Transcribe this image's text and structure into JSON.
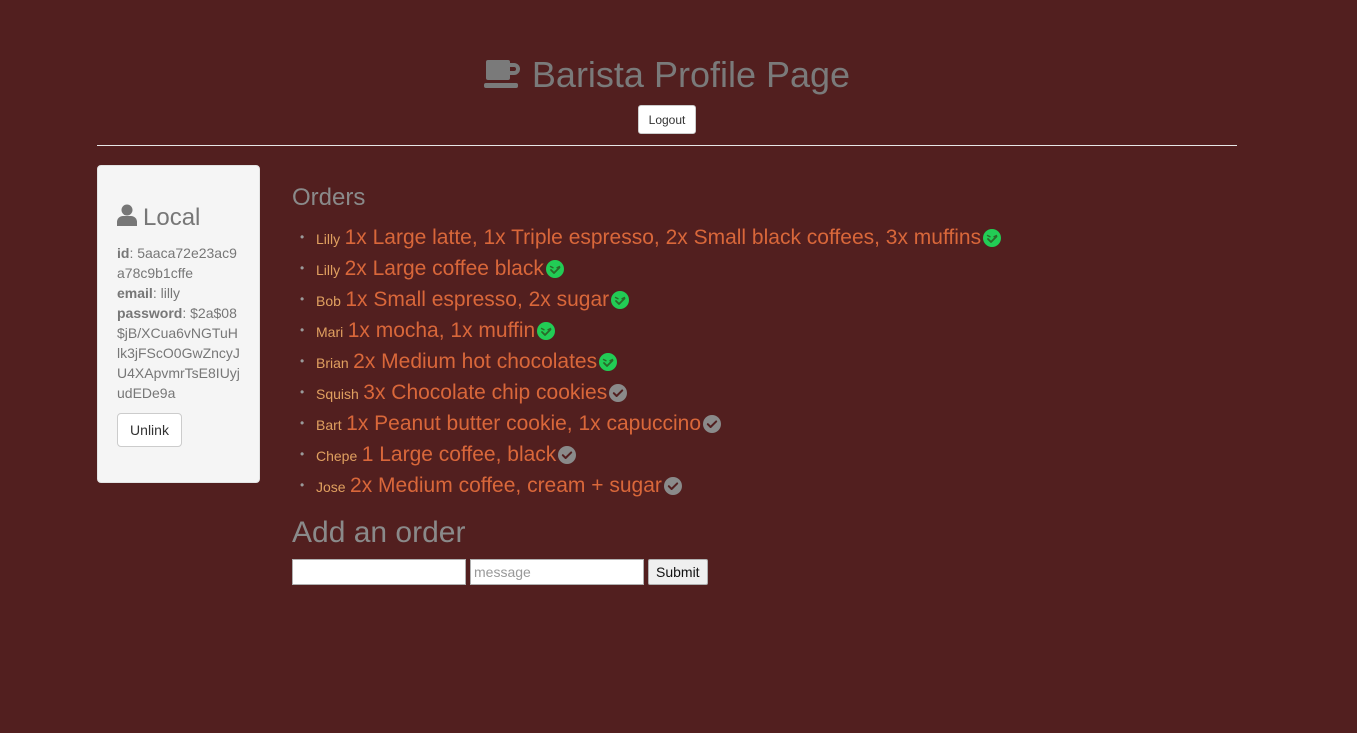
{
  "header": {
    "title": "Barista Profile Page",
    "logout_label": "Logout",
    "icon": "coffee-icon"
  },
  "profile": {
    "title": "Local",
    "icon": "user-icon",
    "id_label": "id",
    "id_value": "5aaca72e23ac9a78c9b1cffe",
    "email_label": "email",
    "email_value": "lilly",
    "password_label": "password",
    "password_value": "$2a$08$jB/XCua6vNGTuHlk3jFScO0GwZncyJU4XApvmrTsE8IUyjudEDe9a",
    "unlink_label": "Unlink"
  },
  "orders": {
    "heading": "Orders",
    "items": [
      {
        "name": "Lilly",
        "order": "1x Large latte, 1x Triple espresso, 2x Small black coffees, 3x muffins",
        "status": "completed",
        "status_icon": "smiley-check-icon"
      },
      {
        "name": "Lilly",
        "order": "2x Large coffee black",
        "status": "completed",
        "status_icon": "smiley-check-icon"
      },
      {
        "name": "Bob",
        "order": "1x Small espresso, 2x sugar",
        "status": "completed",
        "status_icon": "smiley-check-icon"
      },
      {
        "name": "Mari",
        "order": "1x mocha, 1x muffin",
        "status": "completed",
        "status_icon": "smiley-check-icon"
      },
      {
        "name": "Brian",
        "order": "2x Medium hot chocolates",
        "status": "completed",
        "status_icon": "smiley-check-icon"
      },
      {
        "name": "Squish",
        "order": "3x Chocolate chip cookies",
        "status": "pending",
        "status_icon": "check-circle-icon"
      },
      {
        "name": "Bart",
        "order": "1x Peanut butter cookie, 1x capuccino",
        "status": "pending",
        "status_icon": "check-circle-icon"
      },
      {
        "name": "Chepe",
        "order": "1 Large coffee, black",
        "status": "pending",
        "status_icon": "check-circle-icon"
      },
      {
        "name": "Jose",
        "order": "2x Medium coffee, cream + sugar",
        "status": "pending",
        "status_icon": "check-circle-icon"
      }
    ]
  },
  "add_order": {
    "heading": "Add an order",
    "name_value": "",
    "message_placeholder": "message",
    "submit_label": "Submit"
  },
  "colors": {
    "background": "#521f1f",
    "order_text": "#d9673a",
    "order_name": "#e0a060",
    "done_icon": "#22cc55",
    "pending_icon": "#8a8a8a"
  }
}
